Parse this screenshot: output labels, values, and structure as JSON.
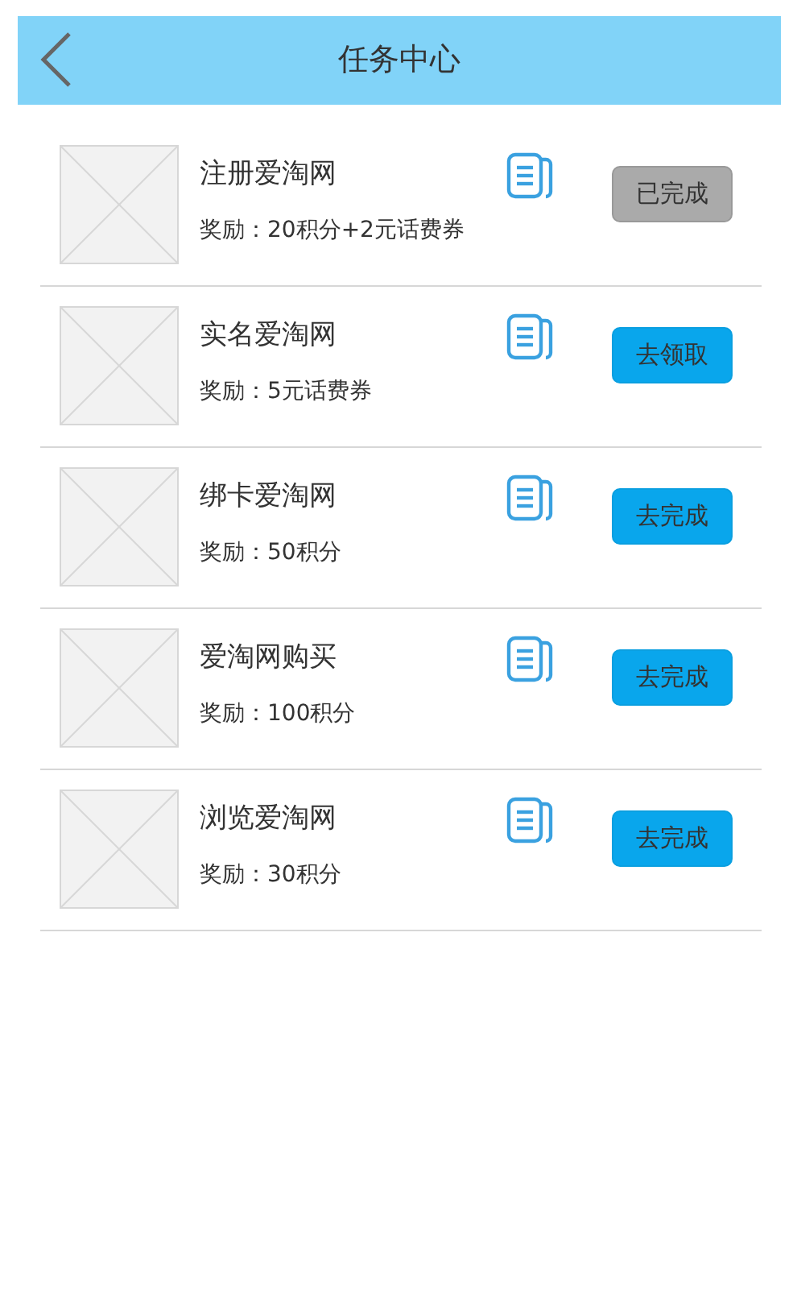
{
  "header": {
    "title": "任务中心"
  },
  "tasks": [
    {
      "name": "注册爱淘网",
      "reward": "奖励：20积分+2元话费券",
      "button": "已完成",
      "completed": true
    },
    {
      "name": "实名爱淘网",
      "reward": "奖励：5元话费券",
      "button": "去领取",
      "completed": false
    },
    {
      "name": "绑卡爱淘网",
      "reward": "奖励：50积分",
      "button": "去完成",
      "completed": false
    },
    {
      "name": "爱淘网购买",
      "reward": "奖励：100积分",
      "button": "去完成",
      "completed": false
    },
    {
      "name": "浏览爱淘网",
      "reward": "奖励：30积分",
      "button": "去完成",
      "completed": false
    }
  ]
}
